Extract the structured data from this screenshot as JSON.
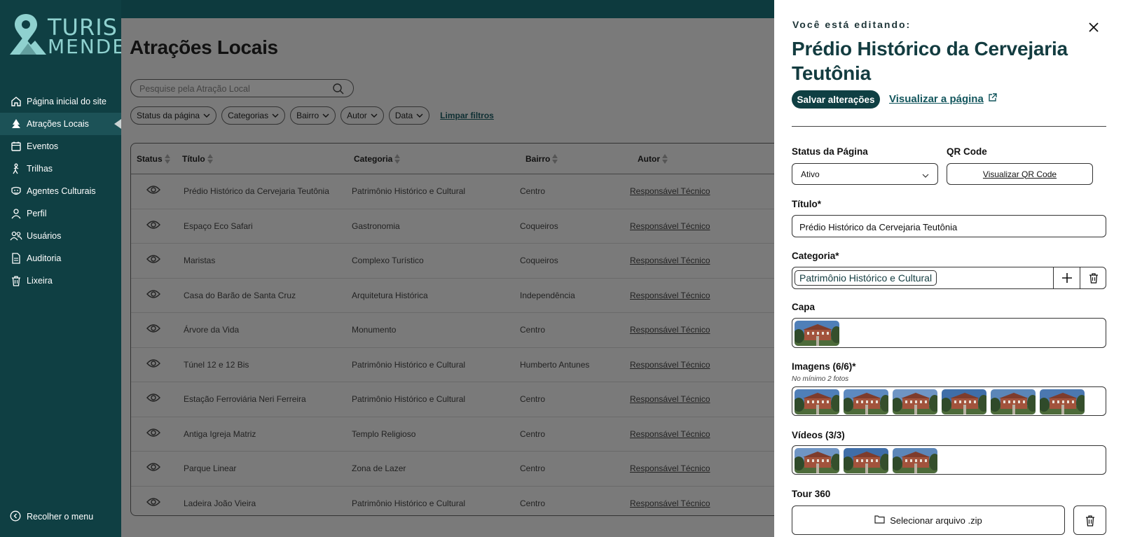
{
  "brand": {
    "line1": "TURIS",
    "line2": "MENDES"
  },
  "sidebar": {
    "items": [
      {
        "label": "Página inicial do site",
        "icon": "home-icon"
      },
      {
        "label": "Atrações Locais",
        "icon": "tree-icon",
        "active": true
      },
      {
        "label": "Eventos",
        "icon": "calendar-icon"
      },
      {
        "label": "Trilhas",
        "icon": "hiker-icon"
      },
      {
        "label": "Agentes Culturais",
        "icon": "badge-icon"
      },
      {
        "label": "Perfil",
        "icon": "user-icon"
      },
      {
        "label": "Usuários",
        "icon": "users-icon"
      },
      {
        "label": "Auditoria",
        "icon": "document-icon"
      },
      {
        "label": "Lixeira",
        "icon": "trash-icon"
      }
    ],
    "collapse_label": "Recolher o menu"
  },
  "main": {
    "title": "Atrações Locais",
    "search_placeholder": "Pesquise pela Atração Local",
    "filters": [
      "Status da página",
      "Categorias",
      "Bairro",
      "Autor",
      "Data"
    ],
    "clear_filters": "Limpar filtros",
    "columns": [
      "Status",
      "Título",
      "Categoria",
      "Bairro",
      "Autor"
    ],
    "rows": [
      {
        "title": "Prédio Histórico da Cervejaria Teutônia",
        "category": "Patrimônio Histórico e Cultural",
        "bairro": "Centro",
        "author": "Responsável Técnico"
      },
      {
        "title": "Espaço Eco Safari",
        "category": "Gastronomia",
        "bairro": "Coqueiros",
        "author": "Responsável Técnico"
      },
      {
        "title": "Maristas",
        "category": "Complexo Turístico",
        "bairro": "Coqueiros",
        "author": "Responsável Técnico"
      },
      {
        "title": "Casa do Barão de Santa Cruz",
        "category": "Arquitetura Histórica",
        "bairro": "Independência",
        "author": "Responsável Técnico"
      },
      {
        "title": "Árvore  da Vida",
        "category": "Monumento",
        "bairro": "Centro",
        "author": "Responsável Técnico"
      },
      {
        "title": "Túnel 12 e 12 Bis",
        "category": "Patrimônio Histórico e Cultural",
        "bairro": "Humberto Antunes",
        "author": "Responsável Técnico"
      },
      {
        "title": "Estação Ferroviária Neri Ferreira",
        "category": "Patrimônio Histórico e Cultural",
        "bairro": "Centro",
        "author": "Responsável Técnico"
      },
      {
        "title": "Antiga Igreja Matriz",
        "category": "Templo Religioso",
        "bairro": "Centro",
        "author": "Responsável Técnico"
      },
      {
        "title": "Parque Linear",
        "category": "Zona de Lazer",
        "bairro": "Centro",
        "author": "Responsável Técnico"
      },
      {
        "title": "Ladeira João Vieira",
        "category": "Patrimônio Histórico e Cultural",
        "bairro": "Centro",
        "author": "Responsável Técnico"
      }
    ]
  },
  "panel": {
    "editing_label": "Você está editando:",
    "title": "Prédio Histórico da Cervejaria Teutônia",
    "save_label": "Salvar alterações",
    "view_page_label": "Visualizar a página",
    "status_label": "Status da Página",
    "status_value": "Ativo",
    "qr_label": "QR Code",
    "qr_button": "Visualizar QR Code",
    "title_label": "Título*",
    "title_value": "Prédio Histórico da Cervejaria Teutônia",
    "category_label": "Categoria*",
    "category_value": "Patrimônio Histórico e Cultural",
    "cover_label": "Capa",
    "images_label": "Imagens (6/6)*",
    "images_hint": "No mínimo 2 fotos",
    "videos_label": "Vídeos (3/3)",
    "tour_label": "Tour 360",
    "zip_button": "Selecionar arquivo .zip"
  },
  "colors": {
    "sidebar": "#0f3f43",
    "accent": "#13565d",
    "logo": "#8fd1cf"
  }
}
